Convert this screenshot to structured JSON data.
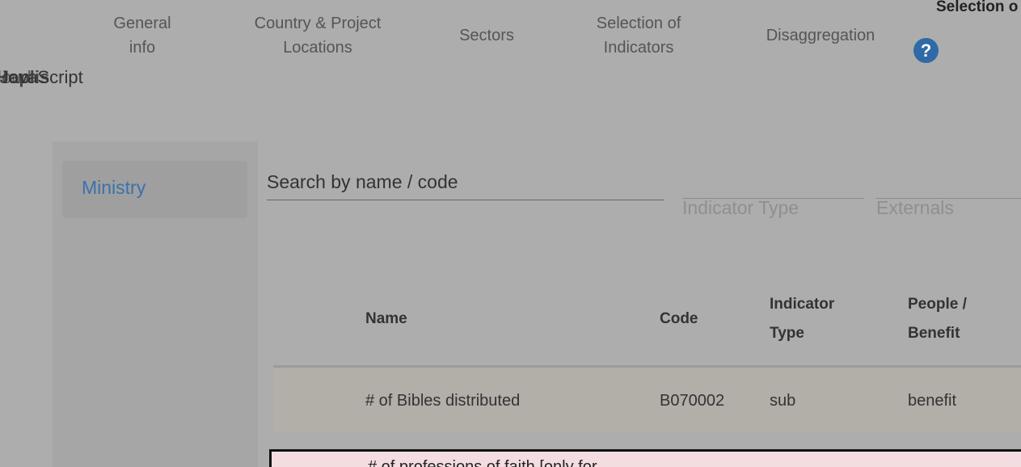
{
  "nav": {
    "tabs": [
      {
        "line1": "General",
        "line2": "info"
      },
      {
        "line1": "Country & Project",
        "line2": "Locations"
      },
      {
        "line1": "Sectors"
      },
      {
        "line1": "Selection of",
        "line2": "Indicators"
      },
      {
        "line1": "Disaggregation"
      }
    ],
    "cut_tab": "Selection o",
    "help_icon": "?"
  },
  "glitch_text": {
    "a": "JavaScript",
    "b": "Hoplis",
    "c": "cloud"
  },
  "sidebar": {
    "items": [
      {
        "label": "Ministry"
      }
    ]
  },
  "filters": {
    "search_placeholder": "Search by name / code",
    "indicator_type_placeholder": "Indicator Type",
    "externals_placeholder": "Externals"
  },
  "table": {
    "headers": {
      "name": "Name",
      "code": "Code",
      "type_line1": "Indicator",
      "type_line2": "Type",
      "people_line1": "People /",
      "people_line2": "Benefit"
    },
    "rows": [
      {
        "name": "# of Bibles distributed",
        "code": "B070002",
        "type": "sub",
        "people": "benefit"
      },
      {
        "name": "# of professions of faith [only for"
      }
    ]
  },
  "colors": {
    "background": "#adadad",
    "accent_blue": "#3a72ab",
    "help_blue": "#2f6aa6",
    "row_highlight": "#b2aea8",
    "row_selected": "#f3dde0"
  }
}
